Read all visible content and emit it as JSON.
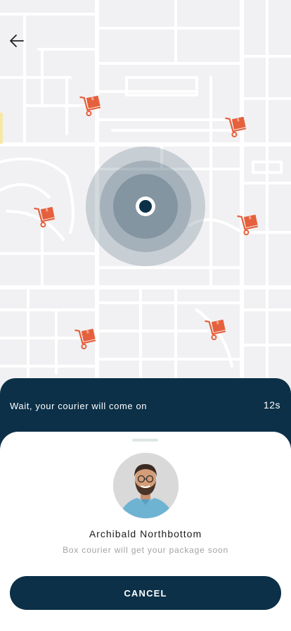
{
  "colors": {
    "primary": "#0b3047",
    "marker": "#e5603c",
    "map_bg": "#f1f1f3",
    "street": "#ffffff"
  },
  "header": {
    "back_icon": "arrow-left-icon"
  },
  "map": {
    "markers_icon": "shopping-cart-box-icon",
    "location_icon": "location-pulse-icon"
  },
  "status": {
    "message": "Wait, your courier will come on",
    "countdown": "12s"
  },
  "courier": {
    "name": "Archibald Northbottom",
    "subtitle": "Box courier will get your package soon"
  },
  "actions": {
    "cancel_label": "CANCEL"
  }
}
